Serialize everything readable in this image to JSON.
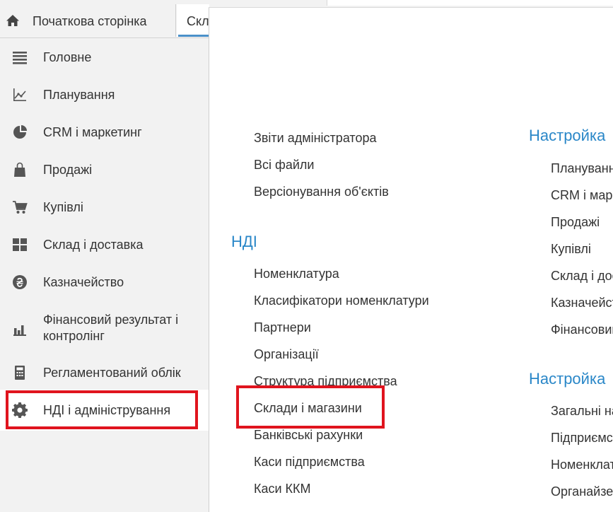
{
  "tabs": {
    "home": "Початкова сторінка",
    "active": "Скл"
  },
  "sidebar": {
    "items": [
      {
        "label": "Головне",
        "icon": "menu-lines-icon"
      },
      {
        "label": "Планування",
        "icon": "chart-axes-icon"
      },
      {
        "label": "CRM і маркетинг",
        "icon": "pie-chart-icon"
      },
      {
        "label": "Продажі",
        "icon": "shopping-bag-icon"
      },
      {
        "label": "Купівлі",
        "icon": "shopping-cart-icon"
      },
      {
        "label": "Склад і доставка",
        "icon": "warehouse-grid-icon"
      },
      {
        "label": "Казначейство",
        "icon": "hryvnia-coin-icon"
      },
      {
        "label": "Фінансовий результат і",
        "label2": "контролінг",
        "icon": "bar-chart-icon"
      },
      {
        "label": "Регламентований облік",
        "icon": "calculator-icon"
      },
      {
        "label": "НДІ і адміністрування",
        "icon": "gear-icon"
      }
    ]
  },
  "main": {
    "col1": {
      "admin_links": [
        "Звіти адміністратора",
        "Всі файли",
        "Версіонування об'єктів"
      ],
      "ndi_title": "НДІ",
      "ndi_links": [
        "Номенклатура",
        "Класифікатори номенклатури",
        "Партнери",
        "Організації",
        "Структура підприємства",
        "Склади і магазини",
        "Банківські рахунки",
        "Каси підприємства",
        "Каси ККМ"
      ]
    },
    "col2": {
      "section1_title": "Настройка",
      "section1_links": [
        "Планування",
        "CRM і маркетинг",
        "Продажі",
        "Купівлі",
        "Склад і доставка",
        "Казначейство",
        "Фінансовий результат"
      ],
      "section2_title": "Настройка",
      "section2_links": [
        "Загальні налаштування",
        "Підприємство",
        "Номенклатура",
        "Органайзер"
      ]
    }
  },
  "colors": {
    "accent": "#2a87c8",
    "highlight": "#e0141e",
    "sidebar_bg": "#f2f2f2"
  }
}
